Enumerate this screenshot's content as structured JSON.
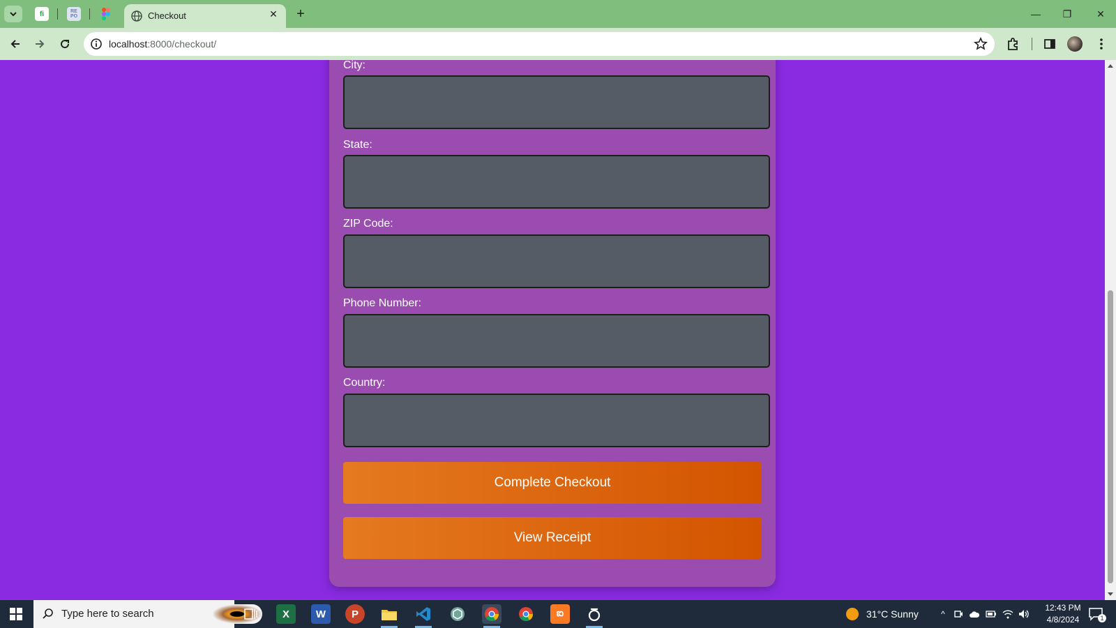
{
  "browser": {
    "tab_title": "Checkout",
    "pinned_tabs": [
      {
        "icon": "fi-icon",
        "text": "fi",
        "color": "#1a9c4a"
      },
      {
        "icon": "repo-icon",
        "text": "RE PO",
        "color": "#6d7ea8"
      },
      {
        "icon": "figma-icon",
        "text": "",
        "color": "#f24e1e"
      }
    ],
    "url_host": "localhost",
    "url_path": ":8000/checkout/"
  },
  "form": {
    "fields": [
      {
        "label": "City:",
        "value": ""
      },
      {
        "label": "State:",
        "value": ""
      },
      {
        "label": "ZIP Code:",
        "value": ""
      },
      {
        "label": "Phone Number:",
        "value": ""
      },
      {
        "label": "Country:",
        "value": ""
      }
    ],
    "buttons": {
      "complete_checkout": "Complete Checkout",
      "view_receipt": "View Receipt"
    }
  },
  "colors": {
    "page_bg": "#8a2be2",
    "card_bg": "#9a4cb0",
    "input_bg": "#555c66",
    "button_start": "#e57a20",
    "button_end": "#d35400",
    "tab_bar": "#7fbe7c"
  },
  "taskbar": {
    "search_placeholder": "Type here to search",
    "apps": [
      "task-view-icon",
      "excel-icon",
      "word-icon",
      "powerpoint-icon",
      "file-explorer-icon",
      "vscode-icon",
      "chatgpt-icon",
      "chrome-icon",
      "chrome-icon",
      "xampp-icon",
      "app-icon"
    ],
    "weather": "31°C  Sunny",
    "time": "12:43 PM",
    "date": "4/8/2024",
    "notification_count": "1"
  }
}
